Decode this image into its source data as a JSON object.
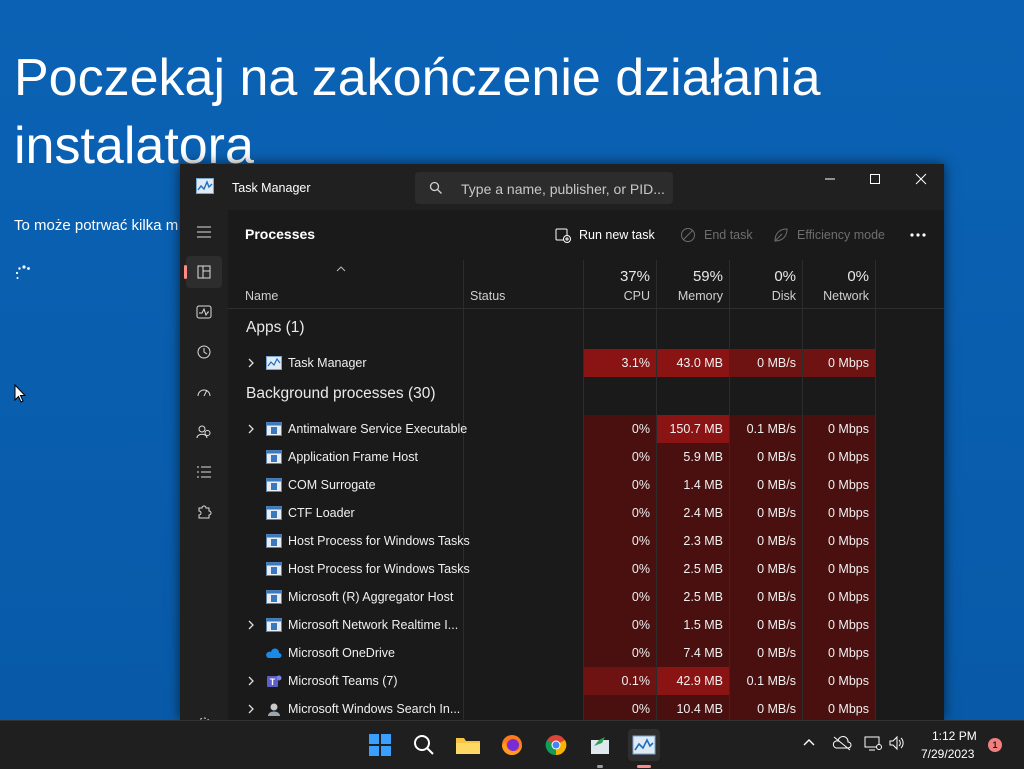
{
  "installer": {
    "title": "Poczekaj na zakończenie działania instalatora",
    "subtitle": "To może potrwać kilka m"
  },
  "window": {
    "title": "Task Manager",
    "search_placeholder": "Type a name, publisher, or PID..."
  },
  "toolbar": {
    "page_title": "Processes",
    "run_new_task": "Run new task",
    "end_task": "End task",
    "efficiency_mode": "Efficiency mode"
  },
  "columns": {
    "name": "Name",
    "status": "Status",
    "cpu_pct": "37%",
    "cpu": "CPU",
    "memory_pct": "59%",
    "memory": "Memory",
    "disk_pct": "0%",
    "disk": "Disk",
    "network_pct": "0%",
    "network": "Network"
  },
  "groups": {
    "apps": "Apps (1)",
    "background": "Background processes (30)"
  },
  "apps": [
    {
      "name": "Task Manager",
      "cpu": "3.1%",
      "memory": "43.0 MB",
      "disk": "0 MB/s",
      "network": "0 Mbps",
      "expandable": true,
      "icon": "taskmgr-icon"
    }
  ],
  "processes": [
    {
      "name": "Antimalware Service Executable",
      "cpu": "0%",
      "memory": "150.7 MB",
      "disk": "0.1 MB/s",
      "network": "0 Mbps",
      "expandable": true,
      "icon": "service-icon"
    },
    {
      "name": "Application Frame Host",
      "cpu": "0%",
      "memory": "5.9 MB",
      "disk": "0 MB/s",
      "network": "0 Mbps",
      "expandable": false,
      "icon": "service-icon"
    },
    {
      "name": "COM Surrogate",
      "cpu": "0%",
      "memory": "1.4 MB",
      "disk": "0 MB/s",
      "network": "0 Mbps",
      "expandable": false,
      "icon": "service-icon"
    },
    {
      "name": "CTF Loader",
      "cpu": "0%",
      "memory": "2.4 MB",
      "disk": "0 MB/s",
      "network": "0 Mbps",
      "expandable": false,
      "icon": "service-icon"
    },
    {
      "name": "Host Process for Windows Tasks",
      "cpu": "0%",
      "memory": "2.3 MB",
      "disk": "0 MB/s",
      "network": "0 Mbps",
      "expandable": false,
      "icon": "service-icon"
    },
    {
      "name": "Host Process for Windows Tasks",
      "cpu": "0%",
      "memory": "2.5 MB",
      "disk": "0 MB/s",
      "network": "0 Mbps",
      "expandable": false,
      "icon": "service-icon"
    },
    {
      "name": "Microsoft (R) Aggregator Host",
      "cpu": "0%",
      "memory": "2.5 MB",
      "disk": "0 MB/s",
      "network": "0 Mbps",
      "expandable": false,
      "icon": "service-icon"
    },
    {
      "name": "Microsoft Network Realtime I...",
      "cpu": "0%",
      "memory": "1.5 MB",
      "disk": "0 MB/s",
      "network": "0 Mbps",
      "expandable": true,
      "icon": "service-icon"
    },
    {
      "name": "Microsoft OneDrive",
      "cpu": "0%",
      "memory": "7.4 MB",
      "disk": "0 MB/s",
      "network": "0 Mbps",
      "expandable": false,
      "icon": "onedrive-icon"
    },
    {
      "name": "Microsoft Teams (7)",
      "cpu": "0.1%",
      "memory": "42.9 MB",
      "disk": "0.1 MB/s",
      "network": "0 Mbps",
      "expandable": true,
      "icon": "teams-icon"
    },
    {
      "name": "Microsoft Windows Search In...",
      "cpu": "0%",
      "memory": "10.4 MB",
      "disk": "0 MB/s",
      "network": "0 Mbps",
      "expandable": true,
      "icon": "search-indexer-icon"
    }
  ],
  "taskbar": {
    "time": "1:12 PM",
    "date": "7/29/2023",
    "notifications": "1"
  },
  "colors": {
    "desktop": "#0a5fb0",
    "heat_high": "#8a1414",
    "heat_mid": "#6e1212",
    "heat_low": "#4a1010",
    "accent": "#ff8a8a"
  }
}
